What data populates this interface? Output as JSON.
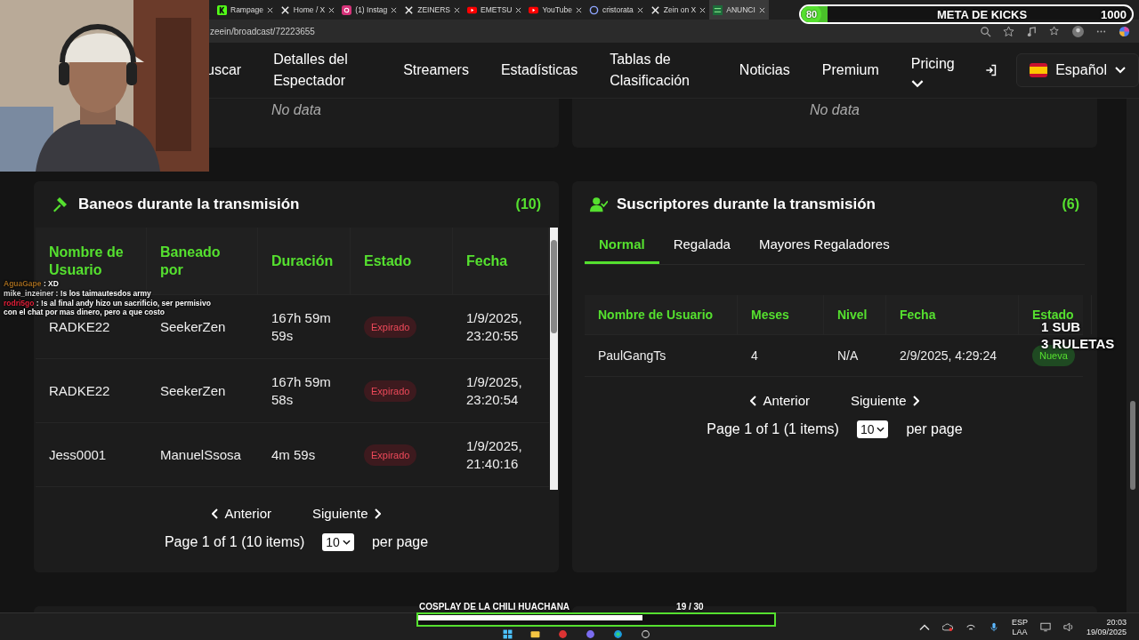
{
  "browser": {
    "tabs": [
      {
        "title": "Rampage",
        "kind": "k",
        "selected": false
      },
      {
        "title": "Home / X",
        "kind": "x",
        "selected": false
      },
      {
        "title": "(1) Instag",
        "kind": "camera",
        "selected": false
      },
      {
        "title": "ZEINERS",
        "kind": "x",
        "selected": false
      },
      {
        "title": "EMETSU",
        "kind": "play",
        "selected": false
      },
      {
        "title": "YouTube",
        "kind": "play",
        "selected": false
      },
      {
        "title": "cristorata",
        "kind": "swirl",
        "selected": false
      },
      {
        "title": "Zein on X",
        "kind": "x",
        "selected": false
      },
      {
        "title": "ANUNCI",
        "kind": "grid",
        "selected": true
      }
    ],
    "url": "zeein/broadcast/72223655"
  },
  "nav": {
    "items": [
      {
        "label": "uscar",
        "kind": "link"
      },
      {
        "label": "Detalles del Espectador",
        "kind": "link"
      },
      {
        "label": "Streamers",
        "kind": "link"
      },
      {
        "label": "Estadísticas",
        "kind": "link"
      },
      {
        "label": "Tablas de Clasificación",
        "kind": "link"
      },
      {
        "label": "Noticias",
        "kind": "link"
      },
      {
        "label": "Premium",
        "kind": "link"
      },
      {
        "label": "Pricing",
        "kind": "dropdown"
      }
    ],
    "language": "Español"
  },
  "top_cards": [
    {
      "message": "No data"
    },
    {
      "message": "No data"
    }
  ],
  "bans": {
    "title": "Baneos durante la transmisión",
    "count": "(10)",
    "columns": [
      "Nombre de Usuario",
      "Baneado por",
      "Duración",
      "Estado",
      "Fecha"
    ],
    "rows": [
      {
        "user": "RADKE22",
        "by": "SeekerZen",
        "duration": "167h 59m 59s",
        "status": "Expirado",
        "kind": "expired",
        "date": "1/9/2025, 23:20:55"
      },
      {
        "user": "RADKE22",
        "by": "SeekerZen",
        "duration": "167h 59m 58s",
        "status": "Expirado",
        "kind": "expired",
        "date": "1/9/2025, 23:20:54"
      },
      {
        "user": "Jess0001",
        "by": "ManuelSsosa",
        "duration": "4m 59s",
        "status": "Expirado",
        "kind": "expired",
        "date": "1/9/2025, 21:40:16"
      }
    ],
    "pagination": {
      "prev": "Anterior",
      "next": "Siguiente",
      "summary": "Page 1 of 1 (10 items)",
      "page_size": "10",
      "per_page": "per page"
    }
  },
  "subs": {
    "title": "Suscriptores durante la transmisión",
    "count": "(6)",
    "tabs": [
      {
        "label": "Normal",
        "selected": true
      },
      {
        "label": "Regalada",
        "selected": false
      },
      {
        "label": "Mayores Regaladores",
        "selected": false
      }
    ],
    "columns": [
      "Nombre de Usuario",
      "Meses",
      "Nivel",
      "Fecha",
      "Estado"
    ],
    "rows": [
      {
        "user": "PaulGangTs",
        "months": "4",
        "level": "N/A",
        "date": "2/9/2025, 4:29:24",
        "status": "Nueva",
        "kind": "new"
      }
    ],
    "pagination": {
      "prev": "Anterior",
      "next": "Siguiente",
      "summary": "Page 1 of 1 (1 items)",
      "page_size": "10",
      "per_page": "per page"
    }
  },
  "overlay": {
    "kicks_goal": {
      "label": "META DE KICKS",
      "current": "80",
      "target": "1000",
      "level": 0.08
    },
    "chat": [
      {
        "name": "AguaGape",
        "message": ": XD",
        "color": "#a06a20"
      },
      {
        "name": "mike_inzeiner",
        "message": ": !s los taimautesdos army",
        "color": "#d8d8d8"
      },
      {
        "name": "rodri5go",
        "message": ": !s al final andy hizo un sacrificio, ser permisivo con el chat por mas dinero, pero a que costo",
        "color": "#e0203a"
      }
    ],
    "sub_note": [
      "1 SUB",
      "3 RULETAS"
    ],
    "bottom_goal": {
      "label": "COSPLAY DE LA CHILI HUACHANA",
      "progress": "19 / 30",
      "level": 0.63
    }
  },
  "taskbar": {
    "language": "ESP",
    "layout": "LAA",
    "time": "20:03",
    "date": "19/09/2025"
  }
}
